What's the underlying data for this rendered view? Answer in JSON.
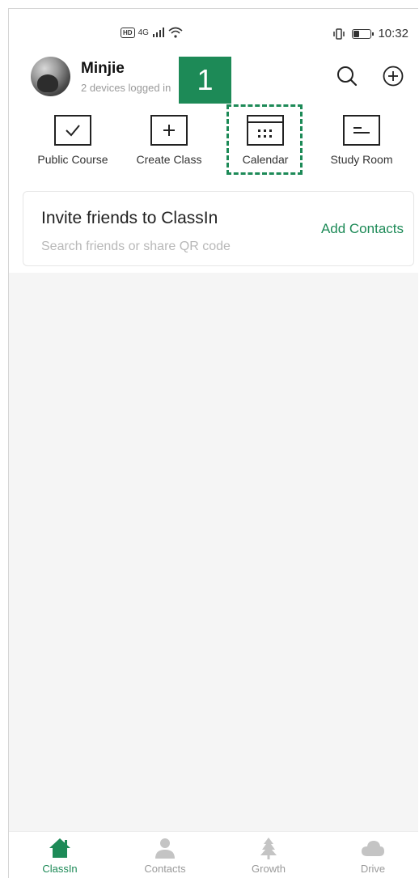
{
  "status_bar": {
    "hd_label": "HD",
    "network_label": "4G",
    "time": "10:32",
    "battery_level": 0.3
  },
  "profile": {
    "name": "Minjie",
    "devices_text": "2 devices logged in"
  },
  "step_badge": "1",
  "quick_actions": [
    {
      "label": "Public Course",
      "icon": "checkbox-icon"
    },
    {
      "label": "Create Class",
      "icon": "plus-box-icon"
    },
    {
      "label": "Calendar",
      "icon": "calendar-icon"
    },
    {
      "label": "Study Room",
      "icon": "note-icon"
    }
  ],
  "invite": {
    "title": "Invite friends to ClassIn",
    "subtitle": "Search friends or share QR code",
    "action": "Add Contacts"
  },
  "bottom_nav": [
    {
      "label": "ClassIn",
      "icon": "home-icon",
      "active": true
    },
    {
      "label": "Contacts",
      "icon": "person-icon",
      "active": false
    },
    {
      "label": "Growth",
      "icon": "tree-icon",
      "active": false
    },
    {
      "label": "Drive",
      "icon": "cloud-icon",
      "active": false
    }
  ],
  "colors": {
    "accent": "#1d8a57",
    "inactive": "#c4c4c4",
    "background": "#f5f5f5"
  }
}
